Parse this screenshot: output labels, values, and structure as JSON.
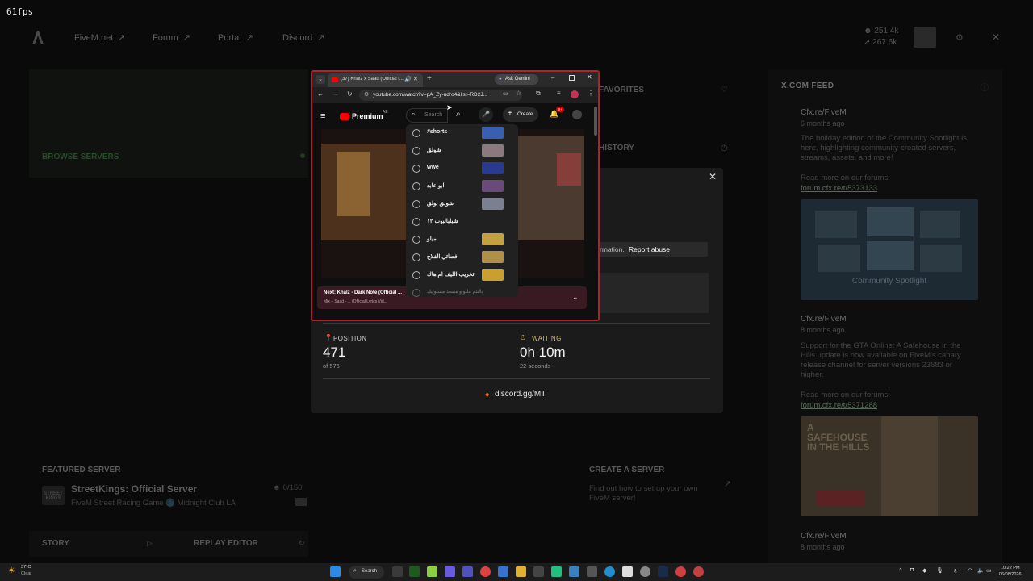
{
  "fps": "61fps",
  "nav": {
    "links": [
      {
        "label": "FiveM.net"
      },
      {
        "label": "Forum"
      },
      {
        "label": "Portal"
      },
      {
        "label": "Discord"
      }
    ],
    "counters": {
      "players": "251.4k",
      "servers": "267.6k"
    }
  },
  "left": {
    "browse_servers": "BROWSE SERVERS",
    "favorites": "FAVORITES",
    "history": "HISTORY",
    "featured_label": "FEATURED SERVER",
    "featured_name": "StreetKings: Official Server",
    "featured_desc": "FiveM Street Racing Game 🌑 Midnight Club LA",
    "featured_count": "0/150",
    "story": "STORY",
    "replay_editor": "REPLAY EDITOR",
    "create_server": "CREATE A SERVER",
    "create_server_desc": "Find out how to set up your own FiveM server!"
  },
  "feed": {
    "title": "X.COM FEED",
    "posts": [
      {
        "author": "Cfx.re/FiveM",
        "date": "6 months ago",
        "body": "The holiday edition of the Community Spotlight is here, highlighting community-created servers, streams, assets, and more!",
        "read_more": "Read more on our forums:",
        "link": "forum.cfx.re/t/5373133",
        "image_caption": "Community Spotlight"
      },
      {
        "author": "Cfx.re/FiveM",
        "date": "8 months ago",
        "body": "Support for the GTA Online: A Safehouse in the Hills update is now available on FiveM's canary release channel for server versions 23683 or higher.",
        "read_more": "Read more on our forums:",
        "link": "forum.cfx.re/t/5371288",
        "image_caption": "A SAFEHOUSE IN THE HILLS"
      },
      {
        "author": "Cfx.re/FiveM",
        "date": "8 months ago"
      }
    ]
  },
  "queue": {
    "report_text": "rmation.",
    "report_link": "Report abuse",
    "position_label": "POSITION",
    "position_value": "471",
    "position_sub": "of 576",
    "waiting_label": "WAITING",
    "waiting_value": "0h 10m",
    "waiting_sub": "22 seconds",
    "discord": "discord.gg/MT"
  },
  "browser": {
    "tab_title": "(37) Khalz x Saad (Official I...",
    "ask_gemini": "Ask Gemini",
    "url": "youtube.com/watch?v=pA_Zy-udro4&list=RD2J...",
    "yt_brand": "Premium",
    "yt_region": "AE",
    "search_placeholder": "Search",
    "create_label": "Create",
    "notif_count": "9+",
    "suggestions": [
      {
        "text": "#shorts"
      },
      {
        "text": "شولق"
      },
      {
        "text": "wwe"
      },
      {
        "text": "ابو عابد"
      },
      {
        "text": "شولق بولق"
      },
      {
        "text": "شبلبالبوب ١٢"
      },
      {
        "text": "ميلو"
      },
      {
        "text": "فضائي الفلاح"
      },
      {
        "text": "تخريب الليف ام هاك"
      },
      {
        "text": "بالنتم ملبو و مسعد مستوليك"
      }
    ],
    "next_label": "Next: Khalz - Dark Note (Official ...",
    "mix_label": "Mix – Saad - ... (Official Lyrics Vid..."
  },
  "taskbar": {
    "weather_temp": "37°C",
    "weather_desc": "Clear",
    "search": "Search",
    "time": "10:22 PM",
    "date": "06/08/2026"
  },
  "colors": {
    "brand_red": "#b3202a",
    "position_icon": "#e0307a",
    "waiting_icon": "#d6b96a",
    "modal_bg": "#1b1b1b",
    "report_link": "#ffffff"
  }
}
